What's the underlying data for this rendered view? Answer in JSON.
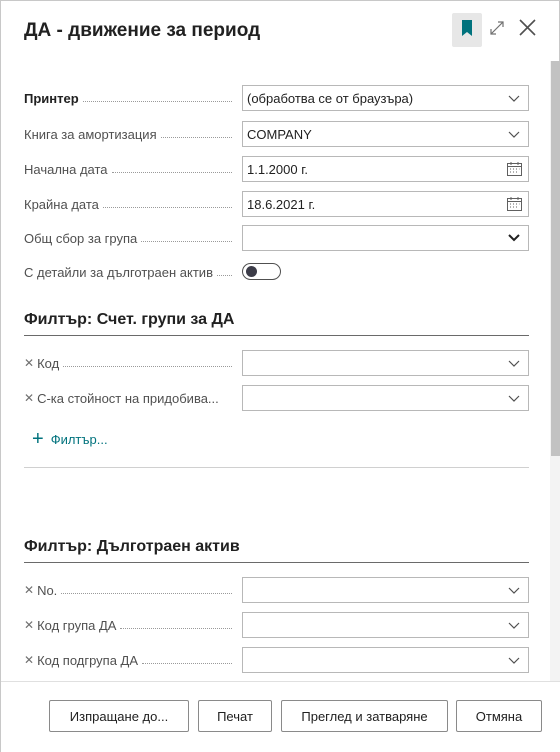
{
  "header": {
    "title": "ДА - движение за период",
    "icons": {
      "bookmark": "bookmark-icon",
      "expand": "expand-icon",
      "close": "close-icon"
    },
    "accent_color": "#00727d"
  },
  "options": {
    "printer": {
      "label": "Принтер",
      "value": "(обработва се от браузъра)"
    },
    "depreciation_book": {
      "label": "Книга за амортизация",
      "value": "COMPANY"
    },
    "start_date": {
      "label": "Начална дата",
      "value": "1.1.2000 г."
    },
    "end_date": {
      "label": "Крайна дата",
      "value": "18.6.2021 г."
    },
    "group_totals": {
      "label": "Общ сбор за група",
      "value": ""
    },
    "asset_details": {
      "label": "С детайли за дълготраен актив",
      "checked": false
    }
  },
  "filter_groups": {
    "title": "Филтър: Счет. групи за ДА",
    "fields": [
      {
        "label": "Код",
        "value": ""
      },
      {
        "label": "С-ка стойност на придобива...",
        "value": ""
      }
    ],
    "add_filter_label": "Филтър..."
  },
  "filter_assets": {
    "title": "Филтър: Дълготраен актив",
    "fields": [
      {
        "label": "No.",
        "value": ""
      },
      {
        "label": "Код група ДА",
        "value": ""
      },
      {
        "label": "Код подгрупа ДА",
        "value": ""
      }
    ]
  },
  "footer": {
    "send_to": "Изпращане до...",
    "print": "Печат",
    "preview_close": "Преглед и затваряне",
    "cancel": "Отмяна"
  }
}
